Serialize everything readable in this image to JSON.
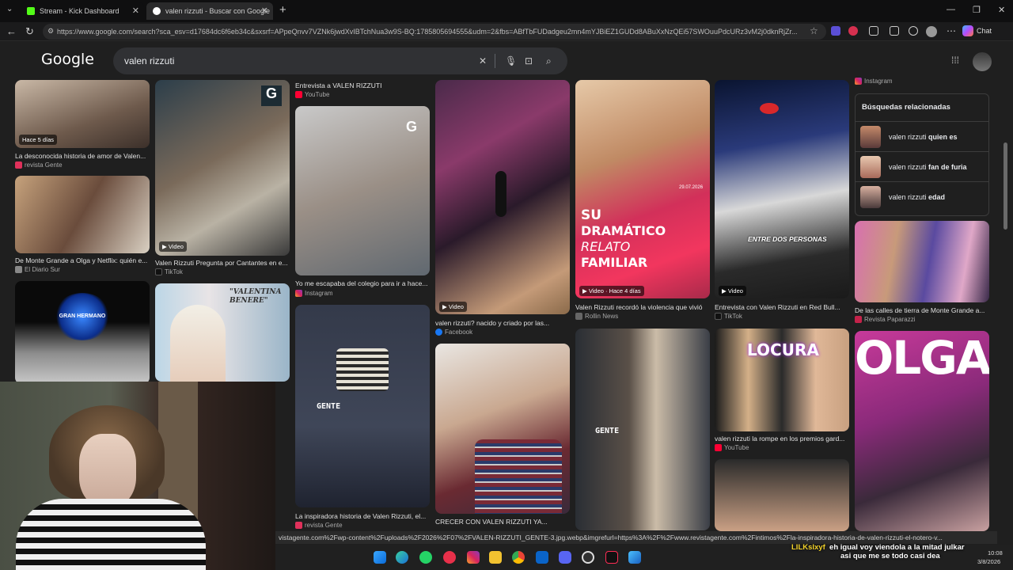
{
  "tabs": [
    {
      "label": "Stream - Kick Dashboard",
      "icon": "kick-icon"
    },
    {
      "label": "valen rizzuti - Buscar con Google",
      "icon": "google-icon"
    }
  ],
  "new_tab": "+",
  "url": "https://www.google.com/search?sca_esv=d17684dc6f6eb34c&sxsrf=APpeQnvv7VZNk6jwdXvIBTchNua3w9S-BQ:1785805694555&udm=2&fbs=ABfTbFUDadgeu2mn4mYJBiEZ1GUDd8ABuXxNzQEi57SWOuuPdcURz3vM2j0dknRjZr...",
  "chat_button": "Chat",
  "google_logo": "Google",
  "search_query": "valen rizzuti",
  "tiles": [
    {
      "badge": "Hace 5 días",
      "caption": "La desconocida historia de amor de Valen...",
      "source": "revista Gente"
    },
    {
      "caption": "De Monte Grande a Olga y Netflix: quién e...",
      "source": "El Diario Sur"
    },
    {
      "overlay": "GRAN HERMANO"
    },
    {
      "badge": "Video",
      "caption": "Valen Rizzuti Pregunta por Cantantes en e...",
      "source": "TikTok"
    },
    {
      "overlay": "\"VALENTINA BENERE\""
    },
    {
      "caption": "Entrevista a VALEN RIZZUTI",
      "source": "YouTube"
    },
    {
      "caption": "Yo me escapaba del colegio para ir a hace...",
      "source": "Instagram"
    },
    {
      "overlay": "GENTE",
      "caption": "La inspiradora historia de Valen Rizzuti, el...",
      "source": "revista Gente"
    },
    {
      "badge": "Video",
      "caption": "valen rizzuti? nacido y criado por las...",
      "source": "Facebook"
    },
    {
      "caption": "CRECER CON VALEN RIZZUTI YA..."
    },
    {
      "overlay_lines": [
        "SU",
        "DRAMÁTICO",
        "RELATO",
        "FAMILIAR"
      ],
      "date": "29.07.2026",
      "badge": "Video · Hace 4 días",
      "caption": "Valen Rizzuti recordó la violencia que vivió",
      "source": "Rollin News"
    },
    {
      "overlay": "GENTE"
    },
    {
      "overlay": "ENTRE DOS PERSONAS",
      "badge": "Video",
      "caption": "Entrevista con Valen Rizzuti en Red Bull...",
      "source": "TikTok"
    },
    {
      "overlay": "LOCURA",
      "caption": "valen rizzuti la rompe en los premios gard...",
      "source": "YouTube"
    },
    {
      "source": "Instagram"
    },
    {
      "caption": "De las calles de tierra de Monte Grande a...",
      "source": "Revista Paparazzi"
    },
    {
      "overlay": "OLGA"
    }
  ],
  "related": {
    "title": "Búsquedas relacionadas",
    "items": [
      {
        "base": "valen rizzuti",
        "bold": "quien es"
      },
      {
        "base": "valen rizzuti",
        "bold": "fan de furia"
      },
      {
        "base": "valen rizzuti",
        "bold": "edad"
      }
    ]
  },
  "status_url": "vistagente.com%2Fwp-content%2Fuploads%2F2026%2F07%2FVALEN-RIZZUTI_GENTE-3.jpg.webp&imgrefurl=https%3A%2F%2Fwww.revistagente.com%2Fintimos%2Fla-inspiradora-historia-de-valen-rizzuti-el-notero-v...",
  "chat": {
    "user": "LILKslxyf",
    "line1": "eh igual voy viendola a la mitad julkar",
    "line2": "asi que me se todo casi dea"
  },
  "clock": {
    "time": "10:08",
    "date": "3/8/2026"
  },
  "colors": {
    "kick": "#53fc18",
    "page_bg": "#1f1f1f",
    "search_bg": "#303134"
  }
}
